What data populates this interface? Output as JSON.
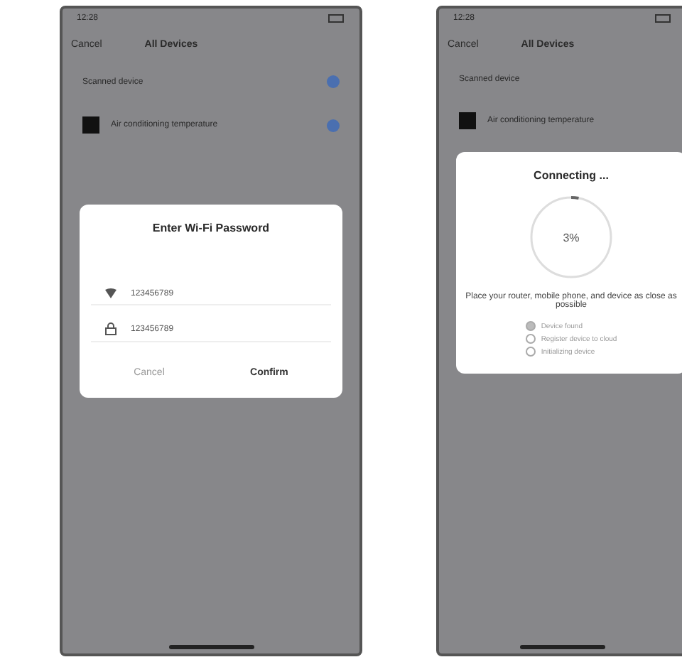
{
  "phones": [
    {
      "status_bar": {
        "time": "12:28"
      },
      "header": {
        "back": "Cancel",
        "title": "All Devices"
      },
      "section": "Scanned device",
      "device": {
        "name": "Air conditioning temperature"
      },
      "dialog": {
        "kind": "password",
        "title": "Enter Wi-Fi Password",
        "fields": [
          {
            "kind": "wifi",
            "value": "123456789"
          },
          {
            "kind": "lock",
            "value": "123456789"
          }
        ],
        "buttons": [
          {
            "label": "Cancel",
            "primary": false
          },
          {
            "label": "Confirm",
            "primary": true
          }
        ]
      }
    },
    {
      "status_bar": {
        "time": "12:28"
      },
      "header": {
        "back": "Cancel",
        "title": "All Devices"
      },
      "section": "Scanned device",
      "device": {
        "name": "Air conditioning temperature"
      },
      "dialog": {
        "kind": "progress",
        "title": "Connecting ...",
        "reading": "3%",
        "level": 0.03,
        "hint": "Place your router, mobile phone, and device as close as possible",
        "steps": [
          {
            "label": "Device found",
            "done": true
          },
          {
            "label": "Register device to cloud",
            "done": false
          },
          {
            "label": "Initializing device",
            "done": false
          }
        ]
      }
    }
  ]
}
